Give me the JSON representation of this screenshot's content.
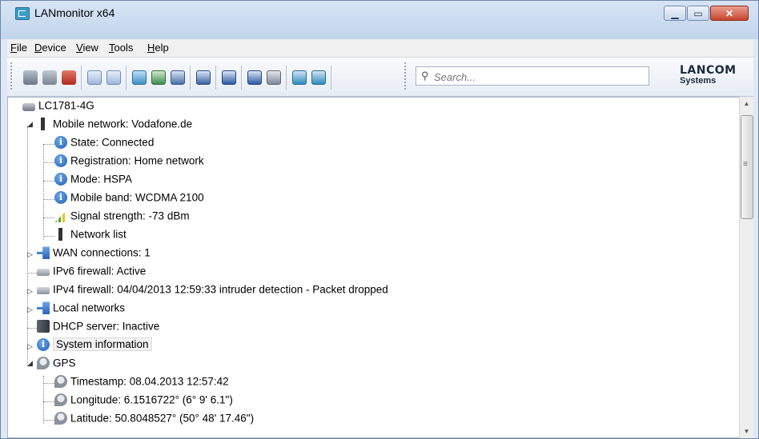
{
  "window": {
    "title": "LANmonitor x64"
  },
  "menu": {
    "items": [
      {
        "key": "F",
        "rest": "ile"
      },
      {
        "key": "D",
        "rest": "evice"
      },
      {
        "key": "V",
        "rest": "iew"
      },
      {
        "key": "T",
        "rest": "ools"
      },
      {
        "key": "H",
        "rest": "elp"
      }
    ]
  },
  "search": {
    "placeholder": "Search..."
  },
  "logo": {
    "line1": "LANCOM",
    "line2": "Systems"
  },
  "tree": {
    "root": "LC1781-4G",
    "mobile_network": "Mobile network: Vodafone.de",
    "state": "State: Connected",
    "registration": "Registration: Home network",
    "mode": "Mode: HSPA",
    "band": "Mobile band: WCDMA 2100",
    "signal": "Signal strength: -73 dBm",
    "network_list": "Network list",
    "wan": "WAN connections: 1",
    "ipv6_fw": "IPv6 firewall: Active",
    "ipv4_fw": "IPv4 firewall: 04/04/2013 12:59:33 intruder detection - Packet dropped",
    "local_networks": "Local networks",
    "dhcp": "DHCP server: Inactive",
    "sysinfo": "System information",
    "gps": "GPS",
    "timestamp": "Timestamp: 08.04.2013 12:57:42",
    "longitude": "Longitude: 6.1516722° (6° 9' 6.1\")",
    "latitude": "Latitude: 50.8048527° (50° 48' 17.46\")"
  }
}
